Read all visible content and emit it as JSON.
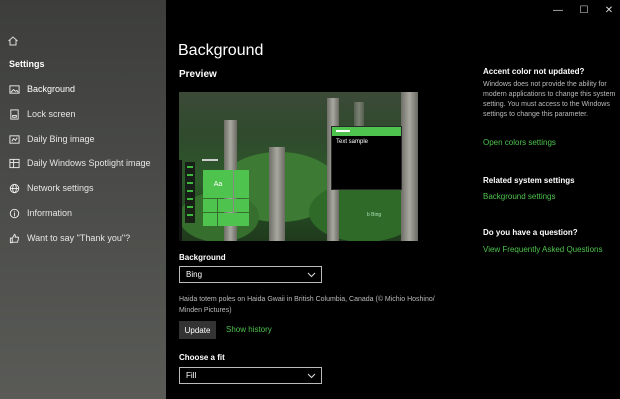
{
  "sidebar": {
    "title": "Settings",
    "items": [
      {
        "label": "Background",
        "icon": "image-icon"
      },
      {
        "label": "Lock screen",
        "icon": "lock-screen-icon"
      },
      {
        "label": "Daily Bing image",
        "icon": "bing-image-icon"
      },
      {
        "label": "Daily Windows Spotlight image",
        "icon": "spotlight-image-icon"
      },
      {
        "label": "Network settings",
        "icon": "globe-icon"
      },
      {
        "label": "Information",
        "icon": "info-icon"
      },
      {
        "label": "Want to say \"Thank you\"?",
        "icon": "thumbs-up-icon"
      }
    ]
  },
  "window": {
    "minimize": "—",
    "maximize": "☐",
    "close": "✕"
  },
  "main": {
    "title": "Background",
    "preview_label": "Preview",
    "preview": {
      "tile_label": "Aa",
      "window_text": "Text sample",
      "watermark": "b Bing"
    },
    "background_label": "Background",
    "background_value": "Bing",
    "caption": "Haida totem poles on Haida Gwaii in British Columbia, Canada (© Michio Hoshino/ Minden Pictures)",
    "update_button": "Update",
    "show_history": "Show history",
    "fit_label": "Choose a fit",
    "fit_value": "Fill"
  },
  "right": {
    "accent_heading": "Accent color not updated?",
    "accent_text": "Windows does not provide the ability for modern applications to change this system setting. You must access to the Windows settings to change this parameter.",
    "open_colors": "Open colors settings",
    "related_heading": "Related system settings",
    "background_settings": "Background settings",
    "question_heading": "Do you have a question?",
    "faq": "View Frequently Asked Questions"
  },
  "colors": {
    "accent": "#4ec34e",
    "sidebar_bg": "#4a4b48",
    "main_bg": "#000000"
  }
}
